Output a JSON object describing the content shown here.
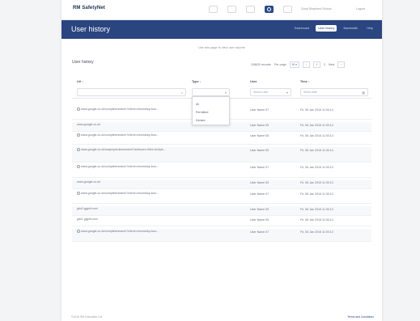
{
  "app": {
    "logo": "RM SafetyNet",
    "school": "Good Shepherd School",
    "logout": "Logout"
  },
  "header": {
    "title": "User history",
    "tabs": [
      "Dashboard",
      "User history",
      "Bandwidth",
      "Help"
    ]
  },
  "instruction": "Use this page to view user reports",
  "section_title": "User history",
  "pager": {
    "records": "248620 records",
    "per_page_label": "Per page",
    "per_page_value": "50",
    "page": "1",
    "of": "2",
    "next": "Next"
  },
  "table": {
    "headers": [
      "Url",
      "Type",
      "User",
      "Time"
    ],
    "filters": {
      "url_placeholder": "",
      "type_placeholder": "",
      "user_placeholder": "Search user",
      "time_placeholder": "Select date"
    },
    "type_options": [
      "All",
      "Permitted",
      "Denied"
    ],
    "rows": [
      {
        "url": "www.google.co.uk/complete/search?client=chrome&q=boo...",
        "icon": true,
        "user": "User Name 07",
        "time": "Fri, 06 Jan 2016 11:00:14"
      },
      {
        "url": "www.google.co.uk",
        "icon": false,
        "user": "User Name 05",
        "time": "Fri, 06 Jan 2016 11:00:14"
      },
      {
        "url": "www.google.co.uk/complete/search?client=chrome&q=boo...",
        "icon": true,
        "user": "User Name 05",
        "time": "Fri, 06 Jan 2016 11:00:14"
      },
      {
        "url": "www.google.co.uk/maps/preview/search?authuser=0&hl=en&pb...",
        "icon": true,
        "user": "User Name 05",
        "time": "Fri, 06 Jan 2016 11:00:14"
      },
      {
        "url": "www.google.co.uk/complete/search?client=chrome&q=boo...",
        "icon": true,
        "user": "User Name 07",
        "time": "Fri, 06 Jan 2016 11:00:13"
      },
      {
        "url": "www.google.co.uk",
        "icon": false,
        "user": "User Name 05",
        "time": "Fri, 06 Jan 2016 11:00:13"
      },
      {
        "url": "www.google.co.uk/complete/search?client=chrome&q=boo...",
        "icon": true,
        "user": "User Name 07",
        "time": "Fri, 06 Jan 2016 11:00:13"
      },
      {
        "url": "gdx2.ggpht.com",
        "icon": false,
        "user": "User Name 05",
        "time": "Fri, 06 Jan 2016 11:00:13"
      },
      {
        "url": "gdx1.ggpht.com",
        "icon": false,
        "user": "User Name 05",
        "time": "Fri, 06 Jan 2016 11:00:13"
      },
      {
        "url": "www.google.co.uk/complete/search?client=chrome&q=boo...",
        "icon": true,
        "user": "User Name 07",
        "time": "Fri, 06 Jan 2016 11:00:13"
      }
    ]
  },
  "footer": {
    "copyright": "©2016 RM Education Ltd.",
    "terms": "Terms and Conditions"
  },
  "colors": {
    "brand": "#2a4580",
    "background": "#f3f4f6"
  }
}
